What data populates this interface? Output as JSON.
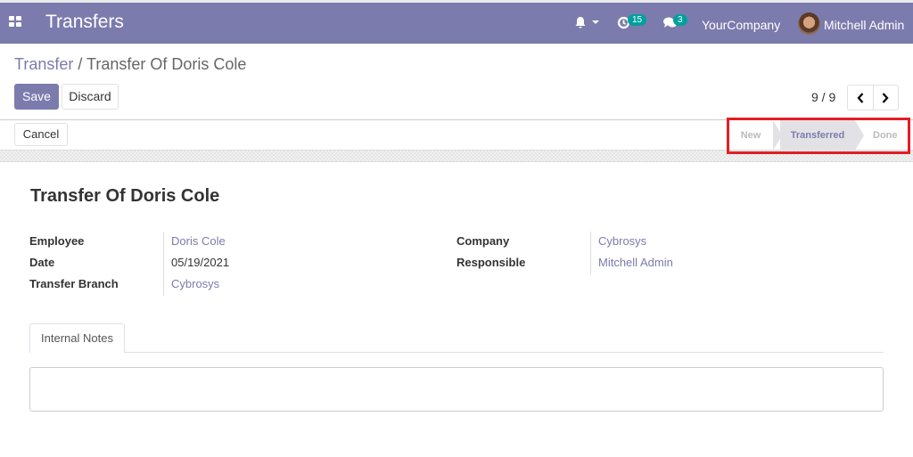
{
  "navbar": {
    "app_title": "Transfers",
    "activity_count": "15",
    "message_count": "3",
    "company": "YourCompany",
    "user": "Mitchell Admin"
  },
  "breadcrumb": {
    "parent": "Transfer",
    "separator": " / ",
    "current": "Transfer Of Doris Cole"
  },
  "actions": {
    "save": "Save",
    "discard": "Discard",
    "cancel": "Cancel"
  },
  "pager": {
    "text": "9 / 9",
    "prev": "‹",
    "next": "›"
  },
  "stages": [
    {
      "label": "New",
      "active": false
    },
    {
      "label": "Transferred",
      "active": true
    },
    {
      "label": "Done",
      "active": false
    }
  ],
  "record": {
    "title": "Transfer Of Doris Cole",
    "left_fields": [
      {
        "label": "Employee",
        "value": "Doris Cole"
      },
      {
        "label": "Date",
        "value": "05/19/2021"
      },
      {
        "label": "Transfer Branch",
        "value": "Cybrosys"
      }
    ],
    "right_fields": [
      {
        "label": "Company",
        "value": "Cybrosys"
      },
      {
        "label": "Responsible",
        "value": "Mitchell Admin"
      }
    ]
  },
  "tabs": {
    "internal_notes": "Internal Notes"
  },
  "colors": {
    "brand": "#7c7bad",
    "badge": "#00a09d",
    "highlight": "#e31e24"
  }
}
